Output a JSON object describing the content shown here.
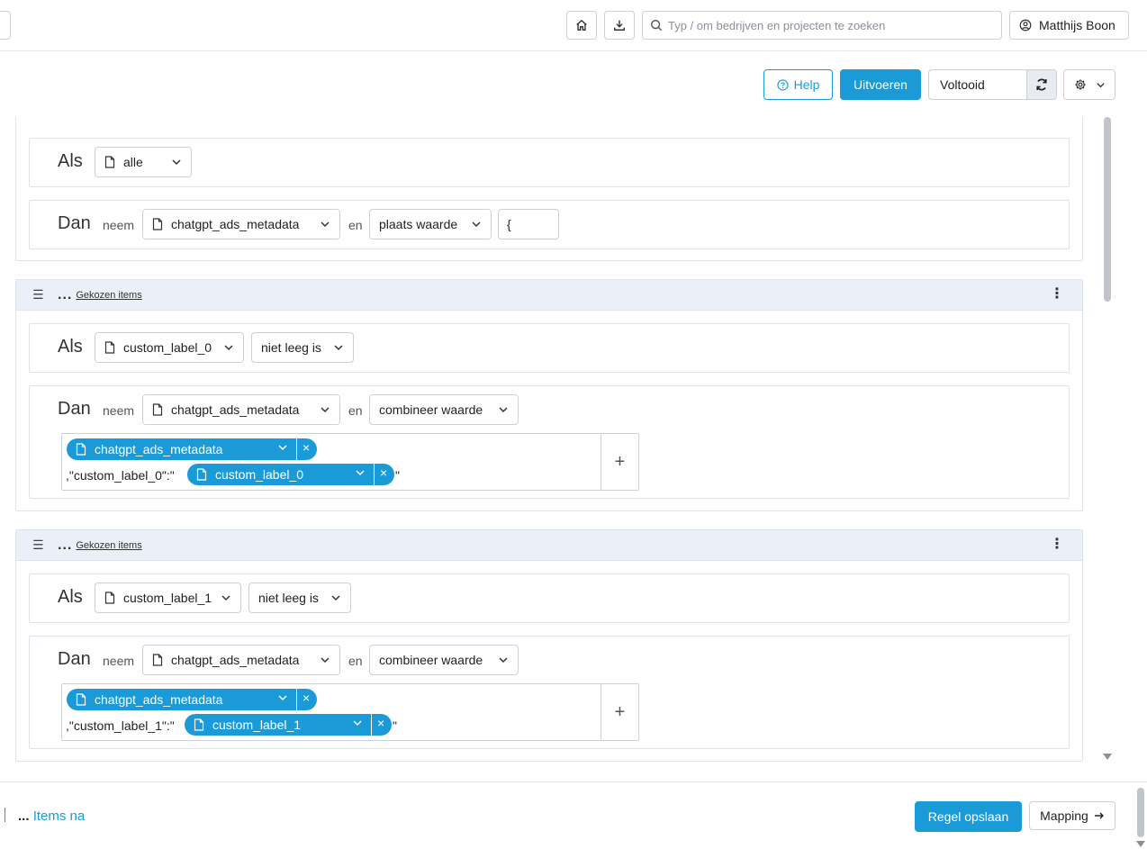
{
  "topbar": {
    "search_placeholder": "Typ / om bedrijven en projecten te zoeken",
    "user_name": "Matthijs Boon",
    "icons": [
      "home-icon",
      "download-icon",
      "search-icon",
      "user-circle-icon"
    ]
  },
  "actionbar": {
    "help_label": "Help",
    "run_label": "Uitvoeren",
    "status_value": "Voltooid"
  },
  "rules": [
    {
      "header": null,
      "if_label": "Als",
      "if_field": "alle",
      "if_operator": "",
      "then_label": "Dan",
      "take_label": "neem",
      "then_field": "chatgpt_ads_metadata",
      "and_label": "en",
      "action": "plaats waarde",
      "value_text": "{"
    },
    {
      "header": {
        "dots": "...",
        "chosen": "Gekozen items"
      },
      "if_label": "Als",
      "if_field": "custom_label_0",
      "if_operator": "niet leeg is",
      "then_label": "Dan",
      "take_label": "neem",
      "then_field": "chatgpt_ads_metadata",
      "and_label": "en",
      "action": "combineer waarde",
      "chip1": "chatgpt_ads_metadata",
      "literal_before": ",\"custom_label_0\":\"",
      "chip2": "custom_label_0",
      "literal_after": "\""
    },
    {
      "header": {
        "dots": "...",
        "chosen": "Gekozen items"
      },
      "if_label": "Als",
      "if_field": "custom_label_1",
      "if_operator": "niet leeg is",
      "then_label": "Dan",
      "take_label": "neem",
      "then_field": "chatgpt_ads_metadata",
      "and_label": "en",
      "action": "combineer waarde",
      "chip1": "chatgpt_ads_metadata",
      "literal_before": ",\"custom_label_1\":\"",
      "chip2": "custom_label_1",
      "literal_after": "\""
    }
  ],
  "footer": {
    "items_na_dots": "...",
    "items_na_label": "Items na",
    "save_label": "Regel opslaan",
    "mapping_label": "Mapping"
  },
  "colors": {
    "accent": "#1a9bd7",
    "header_bg": "#eaf0f7",
    "border": "#dfe4ea"
  }
}
